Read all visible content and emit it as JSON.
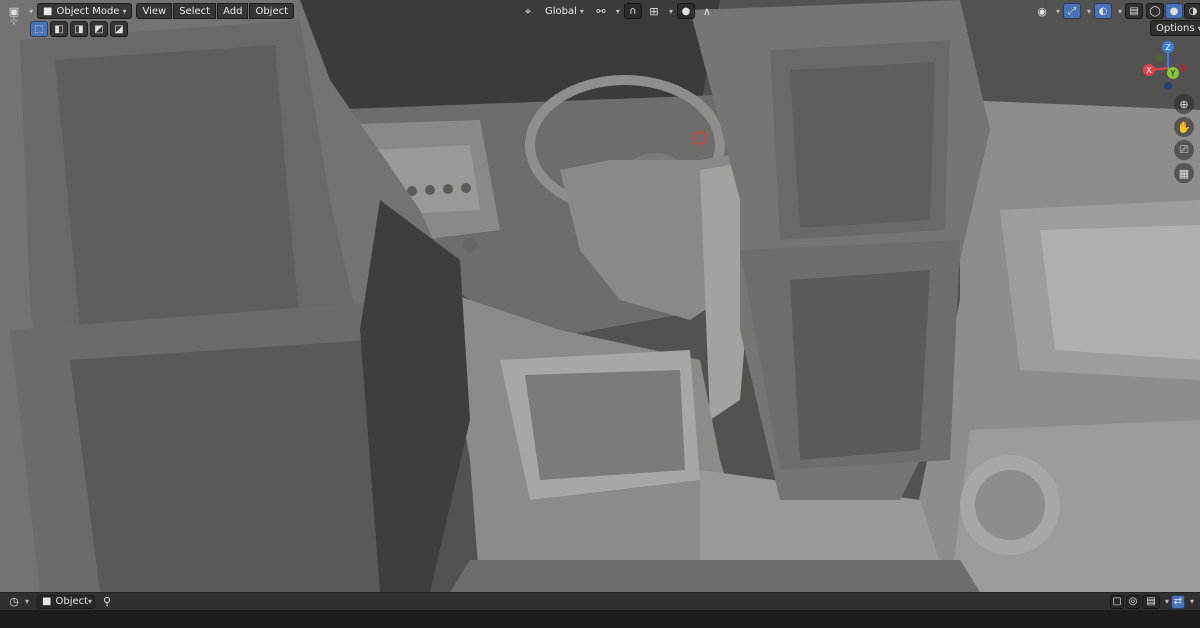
{
  "header": {
    "mode_label": "Object Mode",
    "menus": [
      "View",
      "Select",
      "Add",
      "Object"
    ],
    "transform_orientation": "Global",
    "options_label": "Options"
  },
  "gizmo": {
    "axis_x": "X",
    "axis_y": "Y",
    "axis_z": "Z"
  },
  "footer": {
    "object_label": "Object"
  },
  "colors": {
    "accent": "#4a72b8",
    "axis_x": "#e5414f",
    "axis_y": "#8bc33a",
    "axis_z": "#3a7fe0"
  },
  "icons": {
    "editor_type": "camera-icon",
    "transform_pivot": "pivot-icon",
    "snap": "magnet-icon",
    "proportional": "proportional-icon",
    "zoom": "zoom-icon",
    "pan": "hand-icon",
    "camera_view": "camera-icon",
    "ortho": "grid-icon"
  }
}
